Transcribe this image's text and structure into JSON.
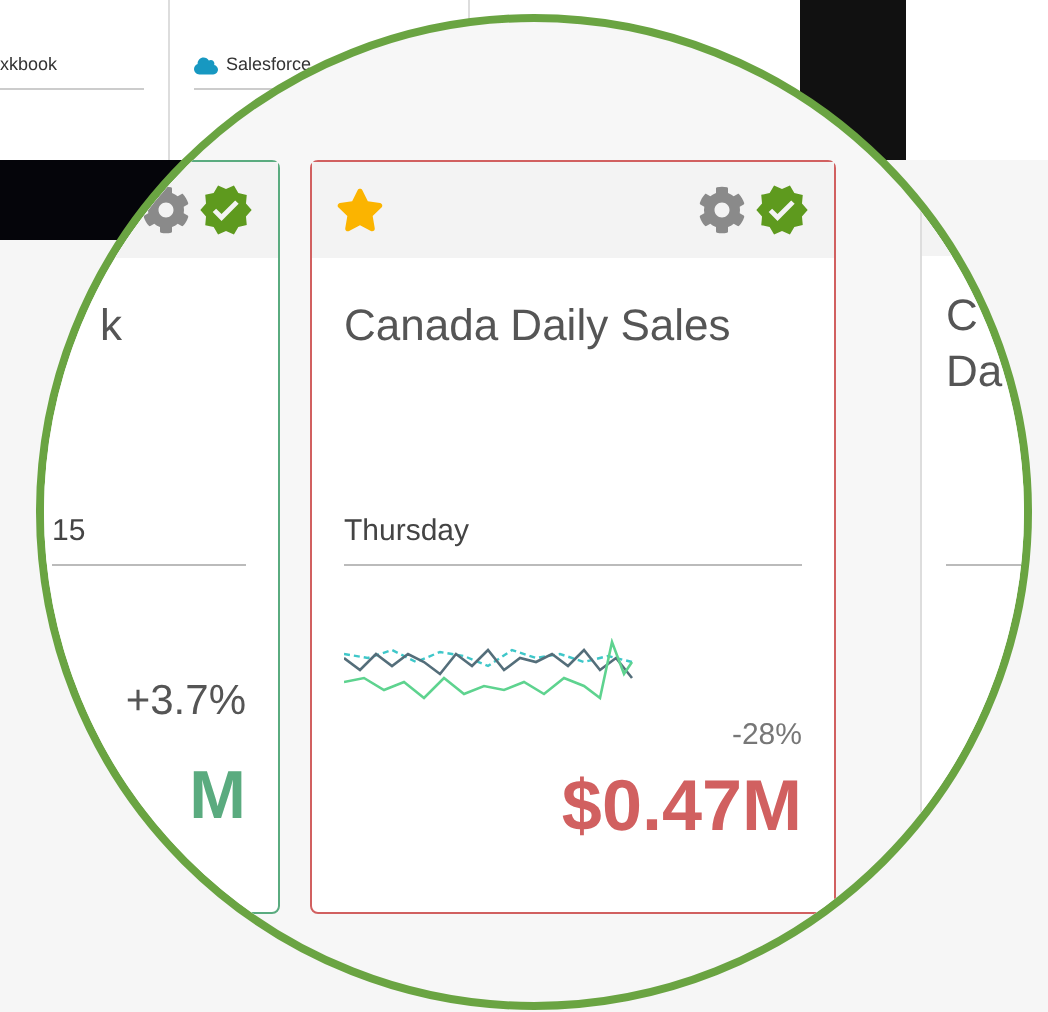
{
  "background": {
    "labels": [
      {
        "text": "xkbook",
        "icon": false
      },
      {
        "text": "Salesforce",
        "icon": true
      }
    ]
  },
  "cards": [
    {
      "kind": "left",
      "title": "k",
      "period": "15",
      "change": "+3.7%",
      "value": "M",
      "color": "#5aab7f",
      "verified": true
    },
    {
      "kind": "main",
      "title": "Canada Daily Sales",
      "period": "Thursday",
      "change": "-28%",
      "value": "$0.47M",
      "color": "#d16060",
      "favorite": true,
      "verified": true
    },
    {
      "kind": "right",
      "title_lines": [
        "C",
        "Da"
      ]
    }
  ]
}
